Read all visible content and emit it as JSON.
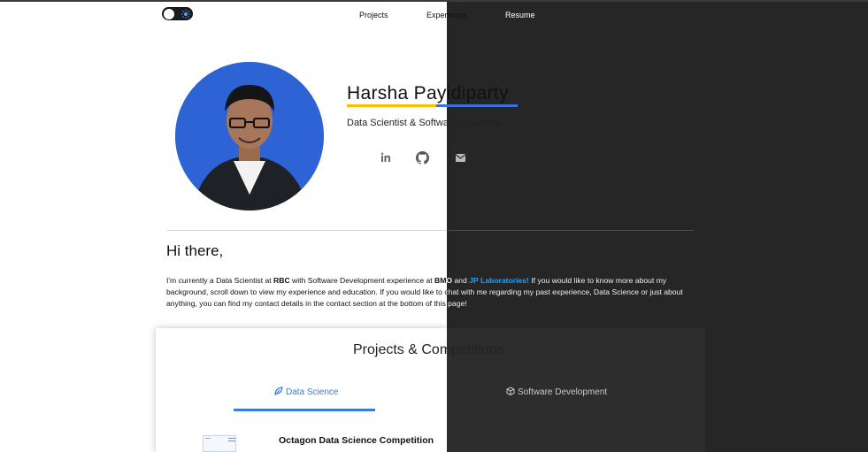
{
  "nav": {
    "toggle_icon": "sun-icon",
    "links": [
      "Projects",
      "Experience",
      "Resume"
    ]
  },
  "hero": {
    "name": "Harsha Payidiparty",
    "subtitle": "Data Scientist & Software Developer",
    "social_icons": [
      "linkedin-icon",
      "github-icon",
      "email-icon"
    ]
  },
  "about": {
    "greeting": "Hi there,",
    "intro_part1": "I'm currently a Data Scientist at ",
    "company": "RBC",
    "intro_part2": " with Software Development experience at ",
    "company2": "BMO",
    "intro_part3": " and ",
    "company3": "JP Laboratories!",
    "intro_part4": " If you would like to know more about my background, scroll down to view my experience and education. If you would like to chat with me regarding my past experience, Data Science or just about anything, you can find my contact details in the contact section at the bottom of this page!"
  },
  "projects": {
    "title": "Projects & Competitions",
    "tabs": [
      "Data Science",
      "Software Development"
    ],
    "tab_icons": [
      "leaf-icon",
      "cube-icon"
    ],
    "first_project_title": "Octagon Data Science Competition"
  },
  "colors": {
    "light_bg": "#ffffff",
    "dark_bg": "#262626",
    "accent_blue": "#3b7be0",
    "accent_yellow": "#f3c200",
    "link_blue": "#1ea0ff",
    "avatar_bg": "#2e63d6"
  }
}
